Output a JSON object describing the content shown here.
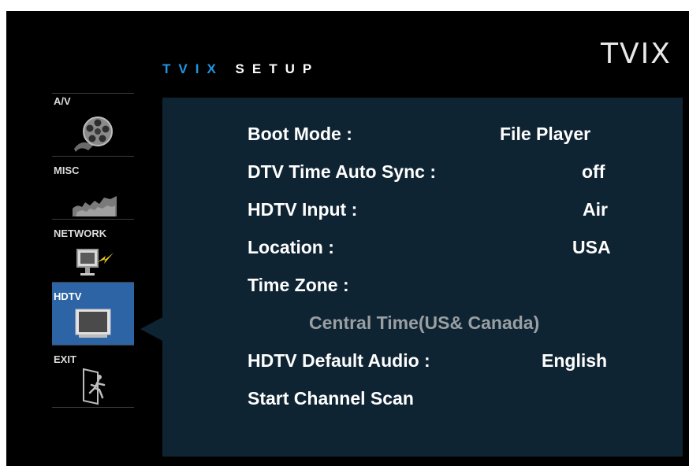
{
  "header": {
    "logo": "TVIX",
    "title_part1": "TVIX",
    "title_part2": "SETUP"
  },
  "sidebar": {
    "items": [
      {
        "label": "A/V",
        "icon": "film-reel-icon"
      },
      {
        "label": "MISC",
        "icon": "gears-icon"
      },
      {
        "label": "NETWORK",
        "icon": "network-computer-icon"
      },
      {
        "label": "HDTV",
        "icon": "tv-icon",
        "active": true
      },
      {
        "label": "EXIT",
        "icon": "exit-door-icon"
      }
    ]
  },
  "settings": {
    "boot_mode": {
      "label": "Boot Mode :",
      "value": "File Player"
    },
    "dtv_time_auto_sync": {
      "label": "DTV Time Auto Sync :",
      "value": "off"
    },
    "hdtv_input": {
      "label": "HDTV Input :",
      "value": "Air"
    },
    "location": {
      "label": "Location :",
      "value": "USA"
    },
    "time_zone": {
      "label": "Time Zone :",
      "value": "Central Time(US& Canada)"
    },
    "hdtv_default_audio": {
      "label": "HDTV Default Audio :",
      "value": "English"
    },
    "start_channel_scan": {
      "label": "Start Channel Scan"
    }
  },
  "colors": {
    "background": "#000000",
    "panel": "#0f2433",
    "accent": "#1f97e5",
    "active_item": "#2d64a6"
  }
}
